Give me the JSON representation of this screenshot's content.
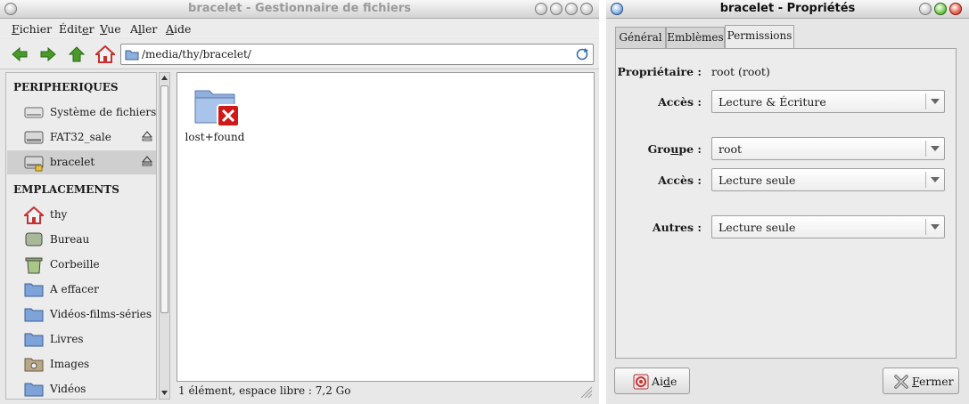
{
  "file_manager": {
    "title": "bracelet - Gestionnaire de fichiers",
    "menu": [
      {
        "pre": "",
        "acc": "F",
        "post": "ichier"
      },
      {
        "pre": "Édit",
        "acc": "e",
        "post": "r"
      },
      {
        "pre": "",
        "acc": "V",
        "post": "ue"
      },
      {
        "pre": "A",
        "acc": "l",
        "post": "ler"
      },
      {
        "pre": "",
        "acc": "A",
        "post": "ide"
      }
    ],
    "location": "/media/thy/bracelet/",
    "sidebar": {
      "peripheriques_heading": "PERIPHERIQUES",
      "devices": [
        {
          "label": "Système de fichiers",
          "icon": "harddisk-icon"
        },
        {
          "label": "FAT32_sale",
          "icon": "drive-icon"
        },
        {
          "label": "bracelet",
          "icon": "usb-drive-icon",
          "selected": true
        }
      ],
      "emplacements_heading": "EMPLACEMENTS",
      "places": [
        {
          "label": "thy",
          "icon": "home-icon"
        },
        {
          "label": "Bureau",
          "icon": "desktop-icon"
        },
        {
          "label": "Corbeille",
          "icon": "trash-icon"
        },
        {
          "label": "A effacer",
          "icon": "folder-icon"
        },
        {
          "label": "Vidéos-films-séries",
          "icon": "folder-icon"
        },
        {
          "label": "Livres",
          "icon": "folder-icon"
        },
        {
          "label": "Images",
          "icon": "pictures-folder-icon"
        },
        {
          "label": "Vidéos",
          "icon": "folder-icon"
        }
      ]
    },
    "files": [
      {
        "name": "lost+found",
        "icon": "folder-noaccess-icon"
      }
    ],
    "status": "1 élément, espace libre : 7,2 Go"
  },
  "properties": {
    "title": "bracelet - Propriétés",
    "tabs": [
      "Général",
      "Emblèmes",
      "Permissions"
    ],
    "active_tab": "Permissions",
    "owner_label": "Propriétaire :",
    "owner_value": "root (root)",
    "owner_access_label": "Accès :",
    "owner_access_value": "Lecture & Écriture",
    "group_label_pre": "Gro",
    "group_label_acc": "u",
    "group_label_post": "pe :",
    "group_value": "root",
    "group_access_label": "Accès :",
    "group_access_value": "Lecture seule",
    "others_label": "Autres :",
    "others_value": "Lecture seule",
    "help_pre": "Ai",
    "help_acc": "d",
    "help_post": "e",
    "close_pre": "",
    "close_acc": "F",
    "close_post": "ermer"
  },
  "colors": {
    "nav_arrow_green": "#4a9a2a",
    "home_red": "#c83232",
    "folder_blue": "#4a78c0",
    "error_red": "#d01818",
    "selection_gray": "#cfcfcf"
  }
}
